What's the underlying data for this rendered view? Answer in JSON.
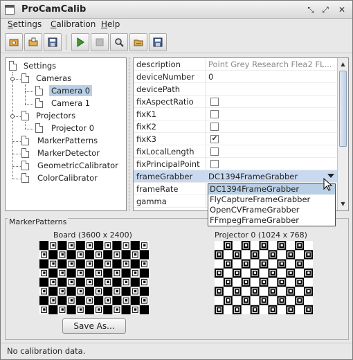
{
  "window": {
    "title": "ProCamCalib"
  },
  "menu": [
    {
      "label": "Settings",
      "mnemonic": "S"
    },
    {
      "label": "Calibration",
      "mnemonic": "C"
    },
    {
      "label": "Help",
      "mnemonic": "H"
    }
  ],
  "toolbar": {
    "icons": [
      "settings-load-icon",
      "open-folder-icon",
      "save-disk-icon",
      "play-icon",
      "stop-icon",
      "zoom-icon",
      "open-folder-icon",
      "save-disk-icon"
    ]
  },
  "tree": {
    "root": "Settings",
    "cameras": "Cameras",
    "camera0": "Camera  0",
    "camera1": "Camera  1",
    "projectors": "Projectors",
    "projector0": "Projector  0",
    "markerPatterns": "MarkerPatterns",
    "markerDetector": "MarkerDetector",
    "geometricCalibrator": "GeometricCalibrator",
    "colorCalibrator": "ColorCalibrator"
  },
  "properties": [
    {
      "key": "description",
      "value": "Point Grey Research Flea2 FL...",
      "type": "text-muted"
    },
    {
      "key": "deviceNumber",
      "value": "0",
      "type": "text"
    },
    {
      "key": "devicePath",
      "value": "",
      "type": "text"
    },
    {
      "key": "fixAspectRatio",
      "checked": false,
      "type": "check"
    },
    {
      "key": "fixK1",
      "checked": false,
      "type": "check"
    },
    {
      "key": "fixK2",
      "checked": false,
      "type": "check"
    },
    {
      "key": "fixK3",
      "checked": true,
      "type": "check"
    },
    {
      "key": "fixLocalLength",
      "checked": false,
      "type": "check"
    },
    {
      "key": "fixPrincipalPoint",
      "checked": false,
      "type": "check"
    },
    {
      "key": "frameGrabber",
      "value": "DC1394FrameGrabber",
      "type": "combo"
    },
    {
      "key": "frameRate",
      "value": "",
      "type": "text"
    },
    {
      "key": "gamma",
      "value": "",
      "type": "text"
    }
  ],
  "dropdown": {
    "options": [
      "DC1394FrameGrabber",
      "FlyCaptureFrameGrabber",
      "OpenCVFrameGrabber",
      "FFmpegFrameGrabber"
    ],
    "selected": "DC1394FrameGrabber"
  },
  "markerPatterns": {
    "label": "MarkerPatterns",
    "board_label": "Board (3600 x 2400)",
    "projector_label": "Projector  0 (1024 x 768)",
    "save_as": "Save As..."
  },
  "status": "No calibration data.",
  "colors": {
    "selection": "#b8cfe5",
    "highlight": "#c9daf0"
  }
}
